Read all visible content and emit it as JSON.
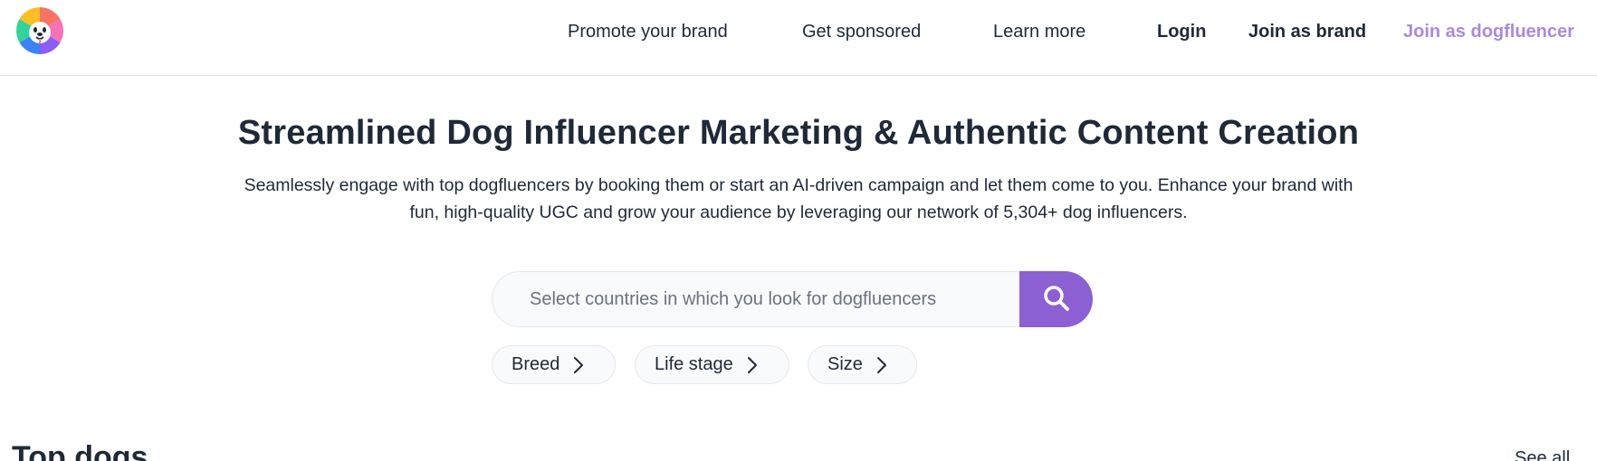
{
  "brand": {
    "logo_icon": "dog-face-camera-aperture-logo",
    "colors": [
      "#f97362",
      "#fbbf24",
      "#34d399",
      "#3b82f6",
      "#8b5cf6"
    ]
  },
  "nav": {
    "promote": "Promote your brand",
    "sponsored": "Get sponsored",
    "learn": "Learn more",
    "login": "Login",
    "join_brand": "Join as brand",
    "join_dog": "Join as dogfluencer"
  },
  "hero": {
    "title": "Streamlined Dog Influencer Marketing & Authentic Content Creation",
    "subtitle_line1": "Seamlessly engage with top dogfluencers by booking them or start an AI-driven campaign and let them come to you. Enhance your brand with",
    "subtitle_line2": "fun, high-quality UGC and grow your audience by leveraging our network of 5,304+ dog influencers."
  },
  "search": {
    "placeholder": "Select countries in which you look for dogfluencers",
    "value": "",
    "button_icon": "search-icon"
  },
  "filters": [
    {
      "label": "Breed",
      "icon": "chevron-right-icon"
    },
    {
      "label": "Life stage",
      "icon": "chevron-right-icon"
    },
    {
      "label": "Size",
      "icon": "chevron-right-icon"
    }
  ],
  "top_dogs": {
    "title": "Top dogs",
    "see_all": "See all"
  },
  "colors": {
    "accent": "#8c5fd3",
    "accent_light": "#a98bdb",
    "text": "#1f2937"
  }
}
